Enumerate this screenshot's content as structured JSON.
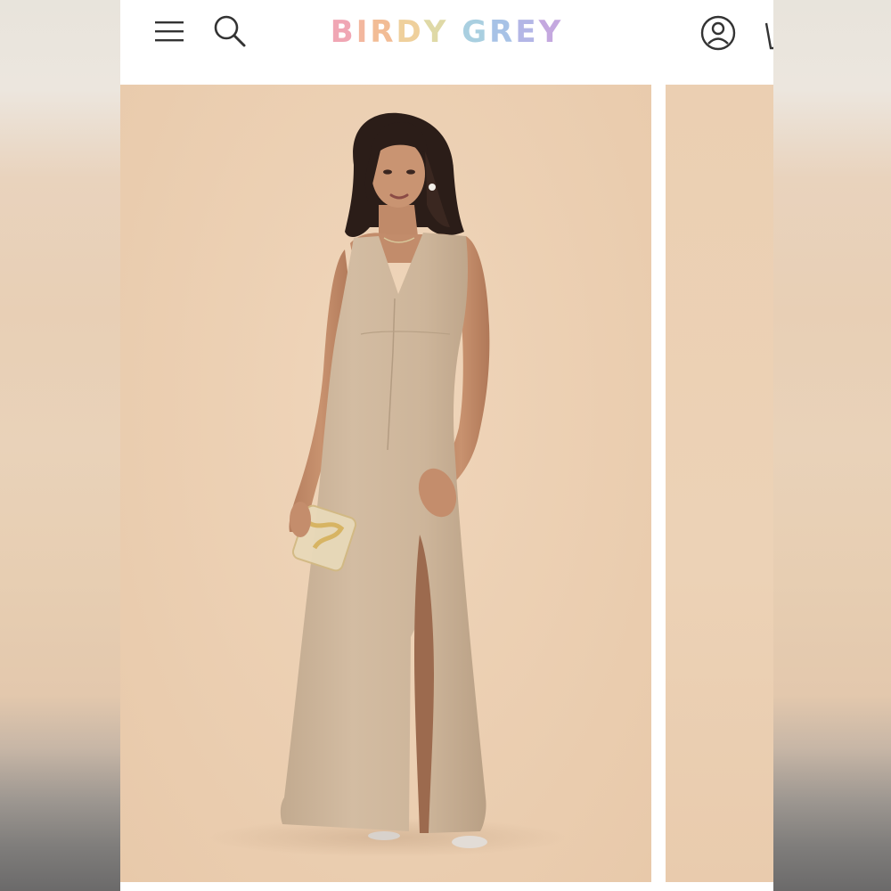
{
  "header": {
    "brand": {
      "letters": [
        {
          "char": "B",
          "color": "#f0a6b4"
        },
        {
          "char": "I",
          "color": "#f3b79e"
        },
        {
          "char": "R",
          "color": "#f2bc95"
        },
        {
          "char": "D",
          "color": "#efd09c"
        },
        {
          "char": "Y",
          "color": "#dfd9a6"
        },
        {
          "char": " ",
          "color": "#ffffff"
        },
        {
          "char": "G",
          "color": "#a9cfe0"
        },
        {
          "char": "R",
          "color": "#a7c2e6"
        },
        {
          "char": "E",
          "color": "#b3b6e6"
        },
        {
          "char": "Y",
          "color": "#c4a8df"
        }
      ]
    },
    "icons": [
      "menu-icon",
      "search-icon",
      "account-icon",
      "cart-icon"
    ]
  },
  "gallery": {
    "colors": {
      "backdrop": "#ecd0b3",
      "dress": "#cfb79c",
      "skin": "#c58f6e",
      "hair": "#2b1d18"
    }
  }
}
